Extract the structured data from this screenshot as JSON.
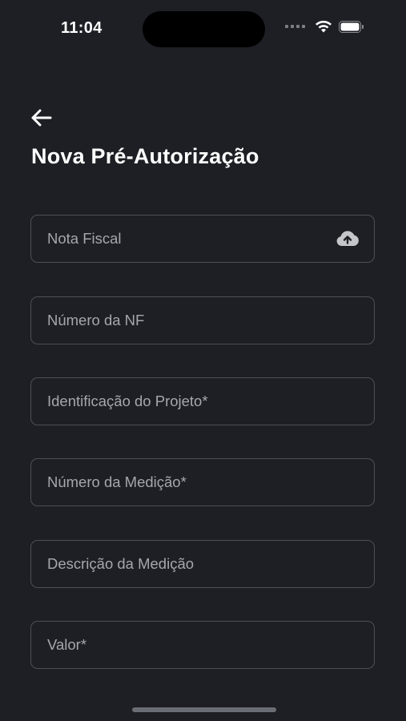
{
  "status_bar": {
    "time": "11:04"
  },
  "header": {
    "title": "Nova Pré-Autorização"
  },
  "fields": [
    {
      "placeholder": "Nota Fiscal",
      "icon": "upload-cloud-icon"
    },
    {
      "placeholder": "Número da NF"
    },
    {
      "placeholder": "Identificação do Projeto*"
    },
    {
      "placeholder": "Número da Medição*"
    },
    {
      "placeholder": "Descrição da Medição"
    },
    {
      "placeholder": "Valor*"
    }
  ],
  "colors": {
    "background": "#1d1f24",
    "field_border": "#4c4f57",
    "placeholder": "#a4a7ad"
  }
}
